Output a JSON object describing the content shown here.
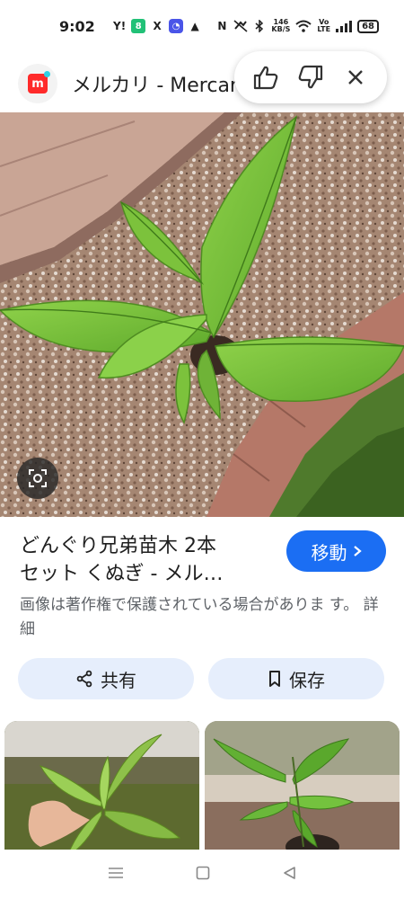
{
  "status_bar": {
    "time": "9:02",
    "app_icons": [
      "Y!",
      "8",
      "X",
      "◔",
      "▲"
    ],
    "nfc": "N",
    "network_speed_value": "146",
    "network_speed_unit": "KB/S",
    "volte_top": "Vo",
    "volte_bottom": "LTE",
    "battery": "68"
  },
  "site": {
    "name": "メルカリ - Mercari",
    "logo_letter": "m",
    "brand_color": "#ff2a2a"
  },
  "feedback": {
    "like_icon": "thumbs-up-icon",
    "dislike_icon": "thumbs-down-icon",
    "close_icon": "close-icon"
  },
  "result": {
    "title_line1": "どんぐり兄弟苗木 2本",
    "title_line2": "セット くぬぎ - メル…",
    "visit_label": "移動",
    "copyright_text": "画像は著作権で保護されている場合がありま す。",
    "details_link": "詳細"
  },
  "actions": {
    "share_label": "共有",
    "save_label": "保存"
  },
  "colors": {
    "accent": "#1b6ef3",
    "chip_bg": "#e6eefc",
    "secondary_text": "#5f6368"
  }
}
